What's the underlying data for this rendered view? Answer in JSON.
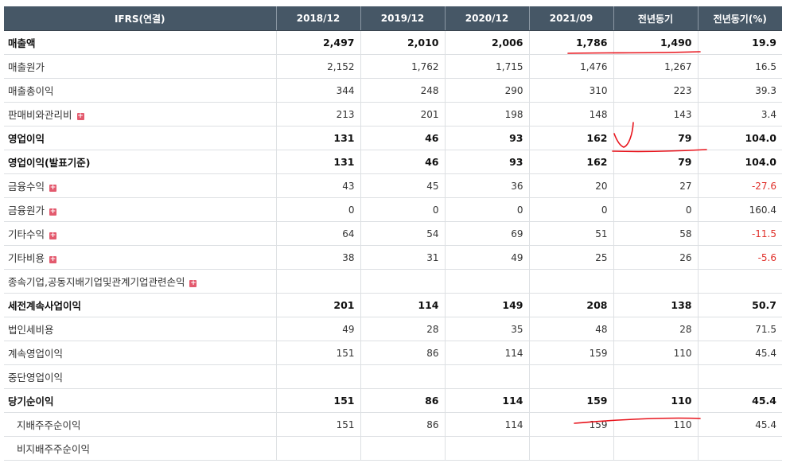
{
  "header": [
    "IFRS(연결)",
    "2018/12",
    "2019/12",
    "2020/12",
    "2021/09",
    "전년동기",
    "전년동기(%)"
  ],
  "rows": [
    {
      "label": "매출액",
      "bold": true,
      "expand": false,
      "sub": false,
      "values": [
        "2,497",
        "2,010",
        "2,006",
        "1,786",
        "1,490",
        "19.9"
      ],
      "neg": false
    },
    {
      "label": "매출원가",
      "bold": false,
      "expand": false,
      "sub": false,
      "values": [
        "2,152",
        "1,762",
        "1,715",
        "1,476",
        "1,267",
        "16.5"
      ],
      "neg": false
    },
    {
      "label": "매출총이익",
      "bold": false,
      "expand": false,
      "sub": false,
      "values": [
        "344",
        "248",
        "290",
        "310",
        "223",
        "39.3"
      ],
      "neg": false
    },
    {
      "label": "판매비와관리비",
      "bold": false,
      "expand": true,
      "sub": false,
      "values": [
        "213",
        "201",
        "198",
        "148",
        "143",
        "3.4"
      ],
      "neg": false
    },
    {
      "label": "영업이익",
      "bold": true,
      "expand": false,
      "sub": false,
      "values": [
        "131",
        "46",
        "93",
        "162",
        "79",
        "104.0"
      ],
      "neg": false
    },
    {
      "label": "영업이익(발표기준)",
      "bold": true,
      "expand": false,
      "sub": false,
      "values": [
        "131",
        "46",
        "93",
        "162",
        "79",
        "104.0"
      ],
      "neg": false
    },
    {
      "label": "금융수익",
      "bold": false,
      "expand": true,
      "sub": false,
      "values": [
        "43",
        "45",
        "36",
        "20",
        "27",
        "-27.6"
      ],
      "neg": true
    },
    {
      "label": "금융원가",
      "bold": false,
      "expand": true,
      "sub": false,
      "values": [
        "0",
        "0",
        "0",
        "0",
        "0",
        "160.4"
      ],
      "neg": false
    },
    {
      "label": "기타수익",
      "bold": false,
      "expand": true,
      "sub": false,
      "values": [
        "64",
        "54",
        "69",
        "51",
        "58",
        "-11.5"
      ],
      "neg": true
    },
    {
      "label": "기타비용",
      "bold": false,
      "expand": true,
      "sub": false,
      "values": [
        "38",
        "31",
        "49",
        "25",
        "26",
        "-5.6"
      ],
      "neg": true
    },
    {
      "label": "종속기업,공동지배기업및관계기업관련손익",
      "bold": false,
      "expand": true,
      "sub": false,
      "values": [
        "",
        "",
        "",
        "",
        "",
        ""
      ],
      "neg": false
    },
    {
      "label": "세전계속사업이익",
      "bold": true,
      "expand": false,
      "sub": false,
      "values": [
        "201",
        "114",
        "149",
        "208",
        "138",
        "50.7"
      ],
      "neg": false
    },
    {
      "label": "법인세비용",
      "bold": false,
      "expand": false,
      "sub": false,
      "values": [
        "49",
        "28",
        "35",
        "48",
        "28",
        "71.5"
      ],
      "neg": false
    },
    {
      "label": "계속영업이익",
      "bold": false,
      "expand": false,
      "sub": false,
      "values": [
        "151",
        "86",
        "114",
        "159",
        "110",
        "45.4"
      ],
      "neg": false
    },
    {
      "label": "중단영업이익",
      "bold": false,
      "expand": false,
      "sub": false,
      "values": [
        "",
        "",
        "",
        "",
        "",
        ""
      ],
      "neg": false
    },
    {
      "label": "당기순이익",
      "bold": true,
      "expand": false,
      "sub": false,
      "values": [
        "151",
        "86",
        "114",
        "159",
        "110",
        "45.4"
      ],
      "neg": false
    },
    {
      "label": "지배주주순이익",
      "bold": false,
      "expand": false,
      "sub": true,
      "values": [
        "151",
        "86",
        "114",
        "159",
        "110",
        "45.4"
      ],
      "neg": false
    },
    {
      "label": "비지배주주순이익",
      "bold": false,
      "expand": false,
      "sub": true,
      "values": [
        "",
        "",
        "",
        "",
        "",
        ""
      ],
      "neg": false
    }
  ],
  "expand_icon": "plus-icon",
  "colors": {
    "header_bg": "#465766",
    "negative": "#e0302a",
    "annotation": "#e8141c"
  }
}
